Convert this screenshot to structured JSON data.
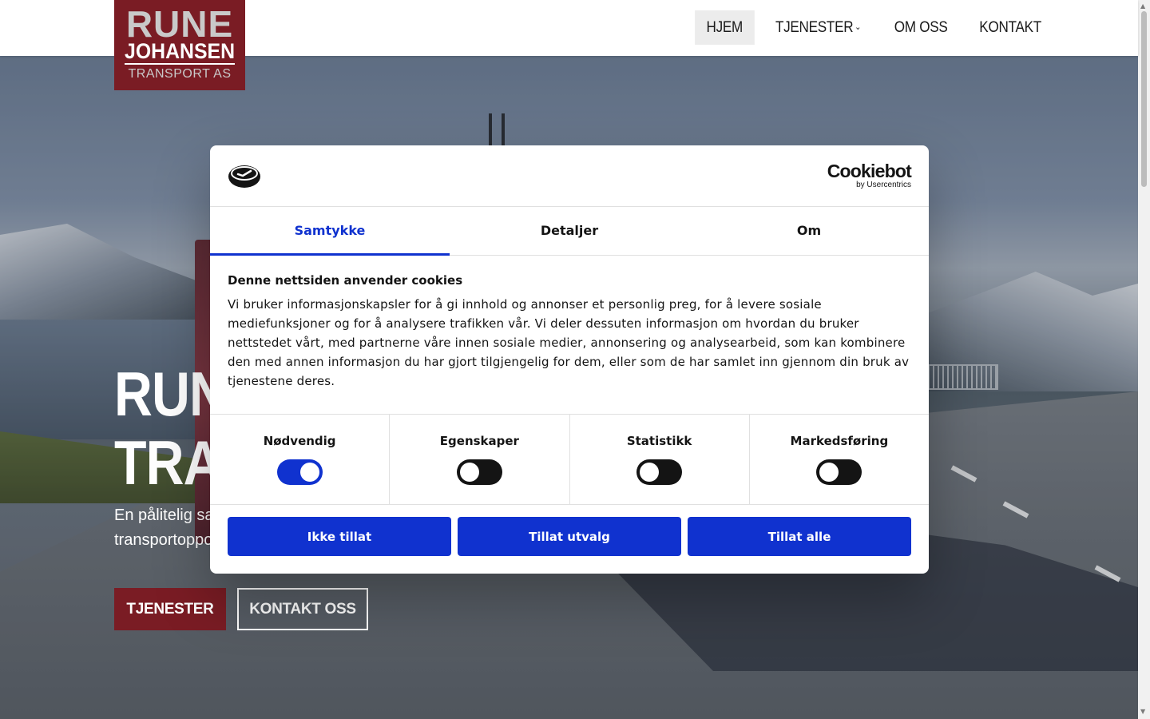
{
  "site": {
    "logo": {
      "line1": "RUNE",
      "line2": "JOHANSEN",
      "line3": "TRANSPORT AS"
    },
    "nav": [
      {
        "label": "HJEM",
        "active": true
      },
      {
        "label": "TJENESTER",
        "has_dropdown": true
      },
      {
        "label": "OM OSS"
      },
      {
        "label": "KONTAKT"
      }
    ],
    "hero": {
      "title": "RUNE JOHANSEN\nTRANSPORT AS",
      "visible_title_fragments": [
        "RUN",
        "TRA"
      ],
      "subtitle_fragments": [
        "En pålitelig sa",
        "transportoppo"
      ],
      "buttons": {
        "primary": "TJENESTER",
        "secondary": "KONTAKT OSS"
      }
    },
    "colors": {
      "brand": "#7a1c24",
      "accent": "#1032cf"
    }
  },
  "cookie_dialog": {
    "brand_name": "Cookiebot",
    "brand_by": "by Usercentrics",
    "tabs": [
      {
        "label": "Samtykke",
        "active": true
      },
      {
        "label": "Detaljer"
      },
      {
        "label": "Om"
      }
    ],
    "heading": "Denne nettsiden anvender cookies",
    "body": "Vi bruker informasjonskapsler for å gi innhold og annonser et personlig preg, for å levere sosiale mediefunksjoner og for å analysere trafikken vår. Vi deler dessuten informasjon om hvordan du bruker nettstedet vårt, med partnerne våre innen sosiale medier, annonsering og analysearbeid, som kan kombinere den med annen informasjon du har gjort tilgjengelig for dem, eller som de har samlet inn gjennom din bruk av tjenestene deres.",
    "categories": [
      {
        "label": "Nødvendig",
        "enabled": true
      },
      {
        "label": "Egenskaper",
        "enabled": false
      },
      {
        "label": "Statistikk",
        "enabled": false
      },
      {
        "label": "Markedsføring",
        "enabled": false
      }
    ],
    "buttons": {
      "deny": "Ikke tillat",
      "allow_selection": "Tillat utvalg",
      "allow_all": "Tillat alle"
    }
  }
}
